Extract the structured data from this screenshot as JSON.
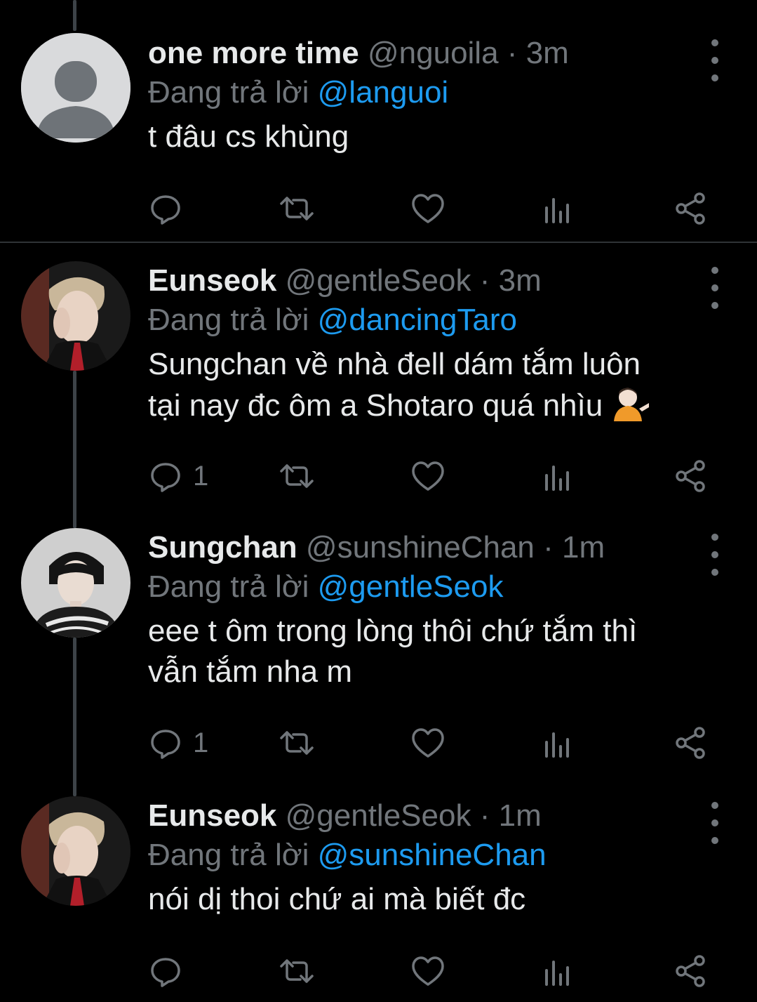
{
  "reply_prefix": "Đang trả lời",
  "colors": {
    "background": "#000000",
    "text": "#e7e9ea",
    "muted": "#71767b",
    "mention": "#1d9bf0",
    "divider": "#2f3336"
  },
  "tweets": [
    {
      "display_name": "one more time",
      "handle": "@nguoila",
      "separator": "·",
      "time": "3m",
      "reply_to": "@languoi",
      "text_lines": [
        "t đâu cs khùng"
      ],
      "reply_count": "",
      "avatar": "default-avatar"
    },
    {
      "display_name": "Eunseok",
      "handle": "@gentleSeok",
      "separator": "·",
      "time": "3m",
      "reply_to": "@dancingTaro",
      "text_lines": [
        "Sungchan về nhà đell dám tắm luôn",
        "tại nay đc ôm a Shotaro quá nhìu"
      ],
      "emoji": "person-tipping-hand-emoji",
      "reply_count": "1",
      "avatar": "photo-avatar"
    },
    {
      "display_name": "Sungchan",
      "handle": "@sunshineChan",
      "separator": "·",
      "time": "1m",
      "reply_to": "@gentleSeok",
      "text_lines": [
        "eee t ôm trong lòng thôi chứ tắm thì",
        "vẫn tắm nha m"
      ],
      "reply_count": "1",
      "avatar": "photo-avatar"
    },
    {
      "display_name": "Eunseok",
      "handle": "@gentleSeok",
      "separator": "·",
      "time": "1m",
      "reply_to": "@sunshineChan",
      "text_lines": [
        "nói dị thoi chứ ai mà biết đc"
      ],
      "reply_count": "",
      "avatar": "photo-avatar"
    }
  ]
}
